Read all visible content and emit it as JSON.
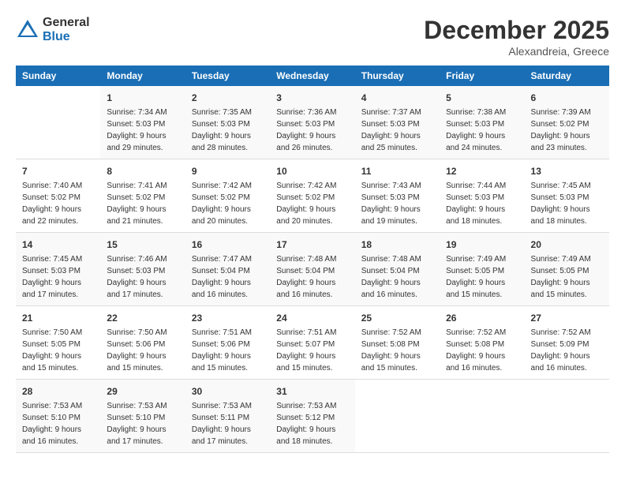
{
  "logo": {
    "general": "General",
    "blue": "Blue"
  },
  "title": "December 2025",
  "location": "Alexandreia, Greece",
  "days_of_week": [
    "Sunday",
    "Monday",
    "Tuesday",
    "Wednesday",
    "Thursday",
    "Friday",
    "Saturday"
  ],
  "weeks": [
    [
      {
        "day": "",
        "sunrise": "",
        "sunset": "",
        "daylight": ""
      },
      {
        "day": "1",
        "sunrise": "Sunrise: 7:34 AM",
        "sunset": "Sunset: 5:03 PM",
        "daylight": "Daylight: 9 hours and 29 minutes."
      },
      {
        "day": "2",
        "sunrise": "Sunrise: 7:35 AM",
        "sunset": "Sunset: 5:03 PM",
        "daylight": "Daylight: 9 hours and 28 minutes."
      },
      {
        "day": "3",
        "sunrise": "Sunrise: 7:36 AM",
        "sunset": "Sunset: 5:03 PM",
        "daylight": "Daylight: 9 hours and 26 minutes."
      },
      {
        "day": "4",
        "sunrise": "Sunrise: 7:37 AM",
        "sunset": "Sunset: 5:03 PM",
        "daylight": "Daylight: 9 hours and 25 minutes."
      },
      {
        "day": "5",
        "sunrise": "Sunrise: 7:38 AM",
        "sunset": "Sunset: 5:03 PM",
        "daylight": "Daylight: 9 hours and 24 minutes."
      },
      {
        "day": "6",
        "sunrise": "Sunrise: 7:39 AM",
        "sunset": "Sunset: 5:02 PM",
        "daylight": "Daylight: 9 hours and 23 minutes."
      }
    ],
    [
      {
        "day": "7",
        "sunrise": "Sunrise: 7:40 AM",
        "sunset": "Sunset: 5:02 PM",
        "daylight": "Daylight: 9 hours and 22 minutes."
      },
      {
        "day": "8",
        "sunrise": "Sunrise: 7:41 AM",
        "sunset": "Sunset: 5:02 PM",
        "daylight": "Daylight: 9 hours and 21 minutes."
      },
      {
        "day": "9",
        "sunrise": "Sunrise: 7:42 AM",
        "sunset": "Sunset: 5:02 PM",
        "daylight": "Daylight: 9 hours and 20 minutes."
      },
      {
        "day": "10",
        "sunrise": "Sunrise: 7:42 AM",
        "sunset": "Sunset: 5:02 PM",
        "daylight": "Daylight: 9 hours and 20 minutes."
      },
      {
        "day": "11",
        "sunrise": "Sunrise: 7:43 AM",
        "sunset": "Sunset: 5:03 PM",
        "daylight": "Daylight: 9 hours and 19 minutes."
      },
      {
        "day": "12",
        "sunrise": "Sunrise: 7:44 AM",
        "sunset": "Sunset: 5:03 PM",
        "daylight": "Daylight: 9 hours and 18 minutes."
      },
      {
        "day": "13",
        "sunrise": "Sunrise: 7:45 AM",
        "sunset": "Sunset: 5:03 PM",
        "daylight": "Daylight: 9 hours and 18 minutes."
      }
    ],
    [
      {
        "day": "14",
        "sunrise": "Sunrise: 7:45 AM",
        "sunset": "Sunset: 5:03 PM",
        "daylight": "Daylight: 9 hours and 17 minutes."
      },
      {
        "day": "15",
        "sunrise": "Sunrise: 7:46 AM",
        "sunset": "Sunset: 5:03 PM",
        "daylight": "Daylight: 9 hours and 17 minutes."
      },
      {
        "day": "16",
        "sunrise": "Sunrise: 7:47 AM",
        "sunset": "Sunset: 5:04 PM",
        "daylight": "Daylight: 9 hours and 16 minutes."
      },
      {
        "day": "17",
        "sunrise": "Sunrise: 7:48 AM",
        "sunset": "Sunset: 5:04 PM",
        "daylight": "Daylight: 9 hours and 16 minutes."
      },
      {
        "day": "18",
        "sunrise": "Sunrise: 7:48 AM",
        "sunset": "Sunset: 5:04 PM",
        "daylight": "Daylight: 9 hours and 16 minutes."
      },
      {
        "day": "19",
        "sunrise": "Sunrise: 7:49 AM",
        "sunset": "Sunset: 5:05 PM",
        "daylight": "Daylight: 9 hours and 15 minutes."
      },
      {
        "day": "20",
        "sunrise": "Sunrise: 7:49 AM",
        "sunset": "Sunset: 5:05 PM",
        "daylight": "Daylight: 9 hours and 15 minutes."
      }
    ],
    [
      {
        "day": "21",
        "sunrise": "Sunrise: 7:50 AM",
        "sunset": "Sunset: 5:05 PM",
        "daylight": "Daylight: 9 hours and 15 minutes."
      },
      {
        "day": "22",
        "sunrise": "Sunrise: 7:50 AM",
        "sunset": "Sunset: 5:06 PM",
        "daylight": "Daylight: 9 hours and 15 minutes."
      },
      {
        "day": "23",
        "sunrise": "Sunrise: 7:51 AM",
        "sunset": "Sunset: 5:06 PM",
        "daylight": "Daylight: 9 hours and 15 minutes."
      },
      {
        "day": "24",
        "sunrise": "Sunrise: 7:51 AM",
        "sunset": "Sunset: 5:07 PM",
        "daylight": "Daylight: 9 hours and 15 minutes."
      },
      {
        "day": "25",
        "sunrise": "Sunrise: 7:52 AM",
        "sunset": "Sunset: 5:08 PM",
        "daylight": "Daylight: 9 hours and 15 minutes."
      },
      {
        "day": "26",
        "sunrise": "Sunrise: 7:52 AM",
        "sunset": "Sunset: 5:08 PM",
        "daylight": "Daylight: 9 hours and 16 minutes."
      },
      {
        "day": "27",
        "sunrise": "Sunrise: 7:52 AM",
        "sunset": "Sunset: 5:09 PM",
        "daylight": "Daylight: 9 hours and 16 minutes."
      }
    ],
    [
      {
        "day": "28",
        "sunrise": "Sunrise: 7:53 AM",
        "sunset": "Sunset: 5:10 PM",
        "daylight": "Daylight: 9 hours and 16 minutes."
      },
      {
        "day": "29",
        "sunrise": "Sunrise: 7:53 AM",
        "sunset": "Sunset: 5:10 PM",
        "daylight": "Daylight: 9 hours and 17 minutes."
      },
      {
        "day": "30",
        "sunrise": "Sunrise: 7:53 AM",
        "sunset": "Sunset: 5:11 PM",
        "daylight": "Daylight: 9 hours and 17 minutes."
      },
      {
        "day": "31",
        "sunrise": "Sunrise: 7:53 AM",
        "sunset": "Sunset: 5:12 PM",
        "daylight": "Daylight: 9 hours and 18 minutes."
      },
      {
        "day": "",
        "sunrise": "",
        "sunset": "",
        "daylight": ""
      },
      {
        "day": "",
        "sunrise": "",
        "sunset": "",
        "daylight": ""
      },
      {
        "day": "",
        "sunrise": "",
        "sunset": "",
        "daylight": ""
      }
    ]
  ]
}
